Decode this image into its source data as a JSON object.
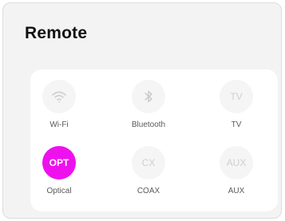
{
  "title": "Remote",
  "accent_color": "#ee11ee",
  "sources": [
    {
      "label": "Wi-Fi",
      "icon": "wifi-icon",
      "active": false
    },
    {
      "label": "Bluetooth",
      "icon": "bluetooth-icon",
      "active": false
    },
    {
      "label": "TV",
      "icon_text": "TV",
      "active": false
    },
    {
      "label": "Optical",
      "icon_text": "OPT",
      "active": true
    },
    {
      "label": "COAX",
      "icon_text": "CX",
      "active": false
    },
    {
      "label": "AUX",
      "icon_text": "AUX",
      "active": false
    }
  ]
}
